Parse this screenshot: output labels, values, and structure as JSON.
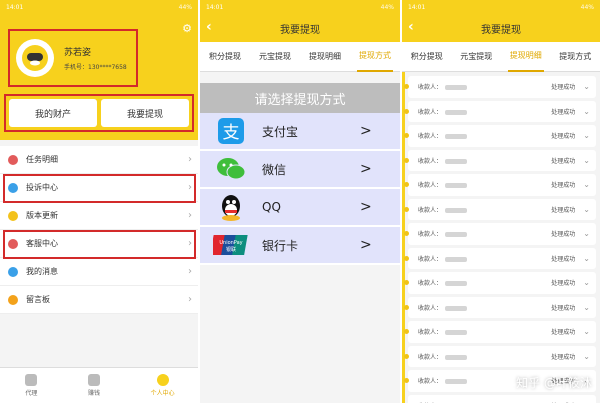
{
  "colors": {
    "accent": "#f7d11d",
    "highlight": "#d32a2a"
  },
  "status": {
    "time": "14:01",
    "battery": "44%"
  },
  "panel1": {
    "user_name": "苏若姿",
    "phone": "手机号：130****7658",
    "btn_assets": "我的财产",
    "btn_withdraw": "我要提现",
    "menu": [
      {
        "label": "任务明细",
        "icon": "task-icon",
        "color": "#e25b5b"
      },
      {
        "label": "投诉中心",
        "icon": "complaint-icon",
        "color": "#3aa0e8"
      },
      {
        "label": "版本更新",
        "icon": "update-icon",
        "color": "#f3c21b"
      },
      {
        "label": "客服中心",
        "icon": "service-icon",
        "color": "#e25b5b"
      },
      {
        "label": "我的消息",
        "icon": "message-icon",
        "color": "#3aa0e8"
      },
      {
        "label": "留言板",
        "icon": "board-icon",
        "color": "#f3a21b"
      }
    ],
    "nav": [
      {
        "label": "代理",
        "icon": "agent-icon"
      },
      {
        "label": "赚钱",
        "icon": "earn-icon"
      },
      {
        "label": "个人中心",
        "icon": "profile-icon"
      }
    ]
  },
  "panel2": {
    "title": "我要提现",
    "tabs": [
      "积分提现",
      "元宝提现",
      "提现明细",
      "提现方式"
    ],
    "select_title": "请选择提现方式",
    "methods": [
      {
        "label": "支付宝",
        "icon": "alipay-icon",
        "bg": "#e1e3fb"
      },
      {
        "label": "微信",
        "icon": "wechat-icon",
        "bg": "#e1e3fb"
      },
      {
        "label": "QQ",
        "icon": "qq-icon",
        "bg": "#e1e3fb"
      },
      {
        "label": "银行卡",
        "icon": "unionpay-icon",
        "bg": "#e1e3fb"
      }
    ],
    "arrow": ">"
  },
  "panel3": {
    "title": "我要提现",
    "tabs": [
      "积分提现",
      "元宝提现",
      "提现明细",
      "提现方式"
    ],
    "row_label": "收款人：",
    "row_status": "处理成功",
    "row_count": 14
  },
  "watermark": "知乎 @叶筱沐"
}
